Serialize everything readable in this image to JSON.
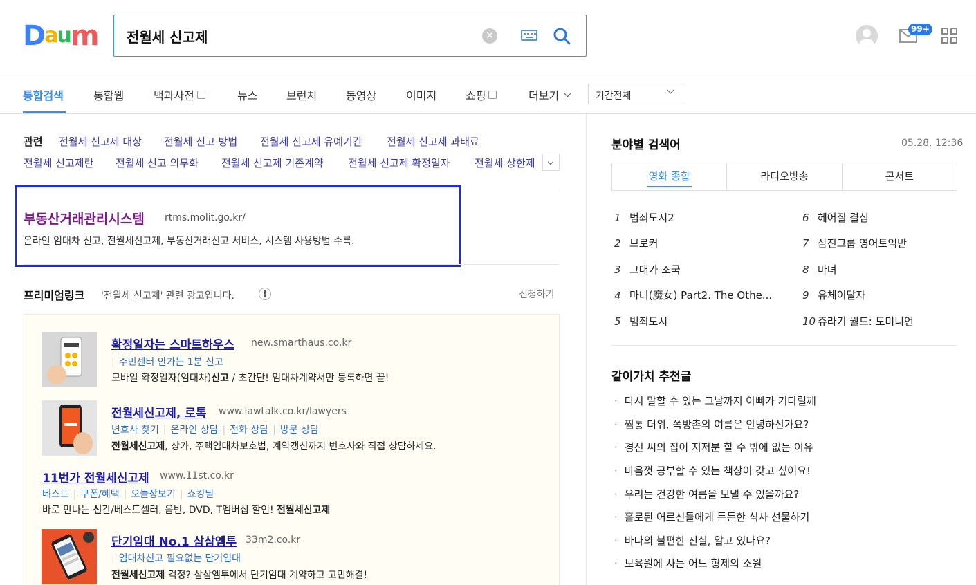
{
  "header": {
    "logo_letters": [
      "D",
      "a",
      "u",
      "m"
    ],
    "logo_colors": [
      "#3b82f6",
      "#f4b400",
      "#2fb55b",
      "#ef5a5a"
    ],
    "search_query": "전월세 신고제",
    "mail_badge": "99+"
  },
  "tabs": {
    "items": [
      "통합검색",
      "통합웹",
      "백과사전",
      "뉴스",
      "브런치",
      "동영상",
      "이미지",
      "쇼핑",
      "더보기"
    ],
    "active": "통합검색",
    "period_select": "기간전체"
  },
  "related": {
    "label": "관련",
    "row1": [
      "전월세 신고제 대상",
      "전월세 신고 방법",
      "전월세 신고제 유예기간",
      "전월세 신고제 과태료"
    ],
    "row2": [
      "전월세 신고제란",
      "전월세 신고 의무화",
      "전월세 신고제 기존계약",
      "전월세 신고제 확정일자",
      "전월세 상한제"
    ]
  },
  "top_result": {
    "title": "부동산거래관리시스템",
    "url": "rtms.molit.go.kr/",
    "desc": "온라인 임대차 신고, 전월세신고제, 부동산거래신고 서비스, 시스템 사용방법 수록."
  },
  "premium": {
    "title": "프리미엄링크",
    "subtitle": "'전월세 신고제' 관련 광고입니다.",
    "info": "!",
    "apply": "신청하기",
    "ads": [
      {
        "title": "확정일자는 스마트하우스",
        "url": "new.smarthaus.co.kr",
        "subs": [
          "주민센터 안가는 1분 신고"
        ],
        "desc_pre": "모바일 확정일자(임대차)",
        "desc_bold": "신고",
        "desc_post": " / 초간단! 임대차계약서만 등록하면 끝!"
      },
      {
        "title": "전월세신고제, 로톡",
        "url": "www.lawtalk.co.kr/lawyers",
        "subs": [
          "변호사 찾기",
          "온라인 상담",
          "전화 상담",
          "방문 상담"
        ],
        "desc_pre": "",
        "desc_bold": "전월세신고제",
        "desc_post": ", 상가, 주택임대차보호법, 계약갱신까지 변호사와 직접 상담하세요."
      },
      {
        "title": "11번가 전월세신고제",
        "url": "www.11st.co.kr",
        "subs": [
          "베스트",
          "쿠폰/혜택",
          "오늘장보기",
          "쇼킹딜"
        ],
        "desc_pre": "바로 만나는 ",
        "desc_bold": "신",
        "desc_post": "간/베스트셀러, 음반, DVD, T멤버십 할인! ",
        "desc_bold2": "전월세신고제"
      },
      {
        "title": "단기임대 No.1 삼삼엠투",
        "url": "33m2.co.kr",
        "subs": [
          "임대차신고 필요없는 단기임대"
        ],
        "desc_pre": "",
        "desc_bold": "전월세신고제",
        "desc_post": " 걱정? 삼삼엠투에서 단기임대 계약하고 고민해결!"
      }
    ]
  },
  "realtime": {
    "title": "분야별 검색어",
    "time": "05.28. 12:36",
    "tabs": [
      "영화 종합",
      "라디오방송",
      "콘서트"
    ],
    "active_tab": "영화 종합",
    "ranks": [
      {
        "num": "1",
        "text": "범죄도시2"
      },
      {
        "num": "2",
        "text": "브로커"
      },
      {
        "num": "3",
        "text": "그대가 조국"
      },
      {
        "num": "4",
        "text": "마녀(魔女) Part2. The Othe..."
      },
      {
        "num": "5",
        "text": "범죄도시"
      },
      {
        "num": "6",
        "text": "헤어질 결심"
      },
      {
        "num": "7",
        "text": "삼진그룹 영어토익반"
      },
      {
        "num": "8",
        "text": "마녀"
      },
      {
        "num": "9",
        "text": "유체이탈자"
      },
      {
        "num": "10",
        "text": "쥬라기 월드: 도미니언"
      }
    ]
  },
  "gachi": {
    "title": "같이가치 추천글",
    "items": [
      "다시 말할 수 있는 그날까지 아빠가 기다릴께",
      "찜통 더위, 쪽방촌의 여름은 안녕하신가요?",
      "경선 씨의 집이 지저분 할 수 밖에 없는 이유",
      "마음껏 공부할 수 있는 책상이 갖고 싶어요!",
      "우리는 건강한 여름을 보낼 수 있을까요?",
      "홀로된 어르신들에게 든든한 식사 선물하기",
      "바다의 불편한 진실, 알고 있나요?",
      "보육원에 사는 어느 형제의 소원"
    ]
  }
}
